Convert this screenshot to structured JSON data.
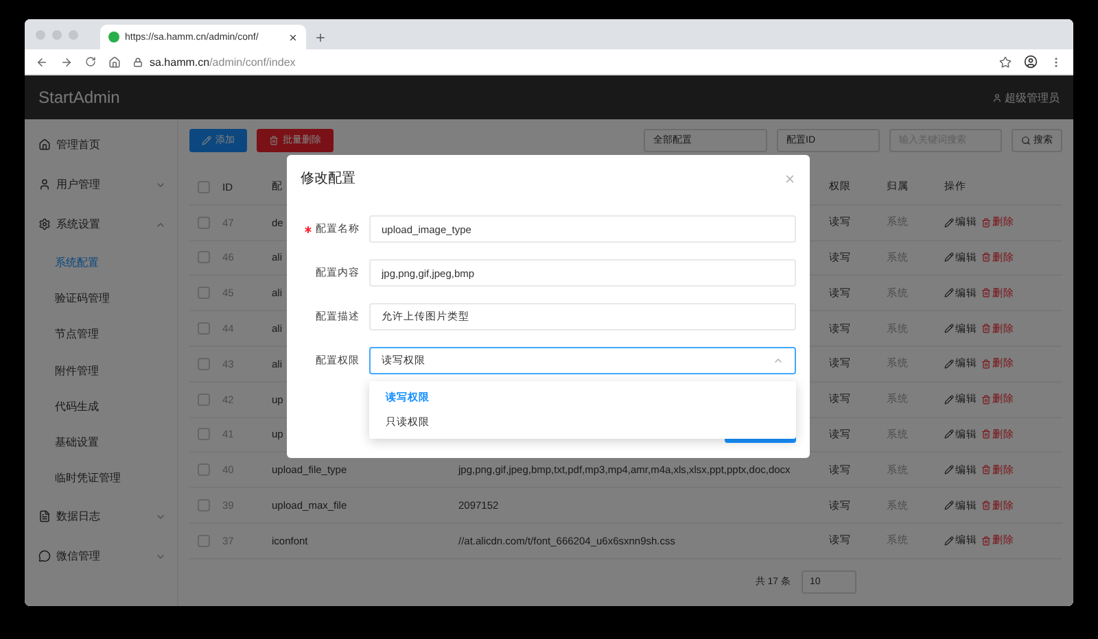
{
  "browser": {
    "tab_title": "https://sa.hamm.cn/admin/conf/",
    "url_host": "sa.hamm.cn",
    "url_path": "/admin/conf/index"
  },
  "header": {
    "brand": "StartAdmin",
    "user": "超级管理员"
  },
  "sidebar": {
    "items": [
      {
        "label": "管理首页",
        "selected": false
      },
      {
        "label": "用户管理",
        "selected": false,
        "expanded": false
      },
      {
        "label": "系统设置",
        "selected": false,
        "expanded": true,
        "children": [
          {
            "label": "系统配置",
            "selected": true
          },
          {
            "label": "验证码管理",
            "selected": false
          },
          {
            "label": "节点管理",
            "selected": false
          },
          {
            "label": "附件管理",
            "selected": false
          },
          {
            "label": "代码生成",
            "selected": false
          },
          {
            "label": "基础设置",
            "selected": false
          },
          {
            "label": "临时凭证管理",
            "selected": false
          }
        ]
      },
      {
        "label": "数据日志",
        "selected": false,
        "expanded": false
      },
      {
        "label": "微信管理",
        "selected": false,
        "expanded": false
      }
    ]
  },
  "toolbar": {
    "buttons": [
      {
        "label": "添加",
        "kind": "primary"
      },
      {
        "label": "批量删除",
        "kind": "danger"
      }
    ],
    "filters": [
      {
        "kind": "select",
        "value": "全部配置"
      },
      {
        "kind": "select",
        "value": "配置ID"
      },
      {
        "kind": "input",
        "placeholder": "输入关键词搜索"
      }
    ],
    "search_button": "搜索"
  },
  "table": {
    "all_checked": false,
    "columns": [
      "ID",
      "配",
      "权限",
      "归属",
      "操作"
    ],
    "rows": [
      {
        "checked": false,
        "id": "47",
        "name": "de",
        "permission": "读写",
        "owner": "系统",
        "actions": [
          "编辑",
          "删除"
        ]
      },
      {
        "checked": false,
        "id": "46",
        "name": "ali",
        "permission": "读写",
        "owner": "系统",
        "actions": [
          "编辑",
          "删除"
        ]
      },
      {
        "checked": false,
        "id": "45",
        "name": "ali",
        "permission": "读写",
        "owner": "系统",
        "actions": [
          "编辑",
          "删除"
        ]
      },
      {
        "checked": false,
        "id": "44",
        "name": "ali",
        "permission": "读写",
        "owner": "系统",
        "actions": [
          "编辑",
          "删除"
        ]
      },
      {
        "checked": false,
        "id": "43",
        "name": "ali",
        "permission": "读写",
        "owner": "系统",
        "actions": [
          "编辑",
          "删除"
        ]
      },
      {
        "checked": false,
        "id": "42",
        "name": "up",
        "permission": "读写",
        "owner": "系统",
        "actions": [
          "编辑",
          "删除"
        ]
      },
      {
        "checked": false,
        "id": "41",
        "name": "up",
        "permission": "读写",
        "owner": "系统",
        "actions": [
          "编辑",
          "删除"
        ]
      },
      {
        "checked": false,
        "id": "40",
        "name": "upload_file_type",
        "value": "jpg,png,gif,jpeg,bmp,txt,pdf,mp3,mp4,amr,m4a,xls,xlsx,ppt,pptx,doc,docx",
        "permission": "读写",
        "owner": "系统",
        "actions": [
          "编辑",
          "删除"
        ]
      },
      {
        "checked": false,
        "id": "39",
        "name": "upload_max_file",
        "value": "2097152",
        "permission": "读写",
        "owner": "系统",
        "actions": [
          "编辑",
          "删除"
        ]
      },
      {
        "checked": false,
        "id": "37",
        "name": "iconfont",
        "value": "//at.alicdn.com/t/font_666204_u6x6sxnn9sh.css",
        "permission": "读写",
        "owner": "系统",
        "actions": [
          "编辑",
          "删除"
        ]
      }
    ]
  },
  "pagination": {
    "total": "共 17 条",
    "page_size": "10"
  },
  "modal": {
    "title": "修改配置",
    "fields": [
      {
        "kind": "input",
        "label": "配置名称",
        "required": true,
        "value": "upload_image_type"
      },
      {
        "kind": "input",
        "label": "配置内容",
        "required": false,
        "value": "jpg,png,gif,jpeg,bmp"
      },
      {
        "kind": "input",
        "label": "配置描述",
        "required": false,
        "value": "允许上传图片类型"
      },
      {
        "kind": "select",
        "label": "配置权限",
        "required": false,
        "value": "读写权限",
        "expanded": true,
        "options": [
          {
            "label": "读写权限",
            "selected": true
          },
          {
            "label": "只读权限",
            "selected": false
          }
        ]
      }
    ]
  }
}
